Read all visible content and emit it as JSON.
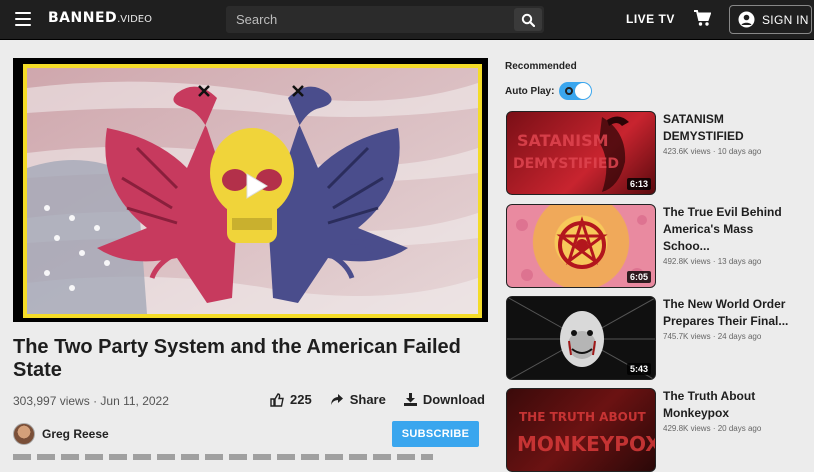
{
  "header": {
    "logo_main": "BANNED",
    "logo_sub": ".VIDEO",
    "search_placeholder": "Search",
    "live_tv": "LIVE TV",
    "sign_in": "SIGN IN"
  },
  "video": {
    "title": "The Two Party System and the American Failed State",
    "views": "303,997 views",
    "date": "Jun 11, 2022",
    "likes": "225",
    "share_label": "Share",
    "download_label": "Download",
    "channel": "Greg Reese",
    "subscribe_label": "SUBSCRIBE"
  },
  "sidebar": {
    "recommended_label": "Recommended",
    "autoplay_label": "Auto Play:",
    "autoplay_on": true,
    "items": [
      {
        "title_line1": "SATANISM DEMYSTIFIED",
        "title_line2": "",
        "views": "423.6K views",
        "age": "10 days ago",
        "duration": "6:13",
        "thumb_text": "SATANISM DEMYSTIFIED"
      },
      {
        "title_line1": "The True Evil Behind",
        "title_line2": "America's Mass Schoo...",
        "views": "492.8K views",
        "age": "13 days ago",
        "duration": "6:05"
      },
      {
        "title_line1": "The New World Order",
        "title_line2": "Prepares Their Final...",
        "views": "745.7K views",
        "age": "24 days ago",
        "duration": "5:43"
      },
      {
        "title_line1": "The Truth About",
        "title_line2": "Monkeypox",
        "views": "429.8K views",
        "age": "20 days ago",
        "duration": "",
        "thumb_text": "THE TRUTH ABOUT MONKEYPOX"
      }
    ]
  },
  "colors": {
    "topbar": "#1f1f1f",
    "accent": "#3aa6ee",
    "frame_yellow": "#f4dc28"
  }
}
